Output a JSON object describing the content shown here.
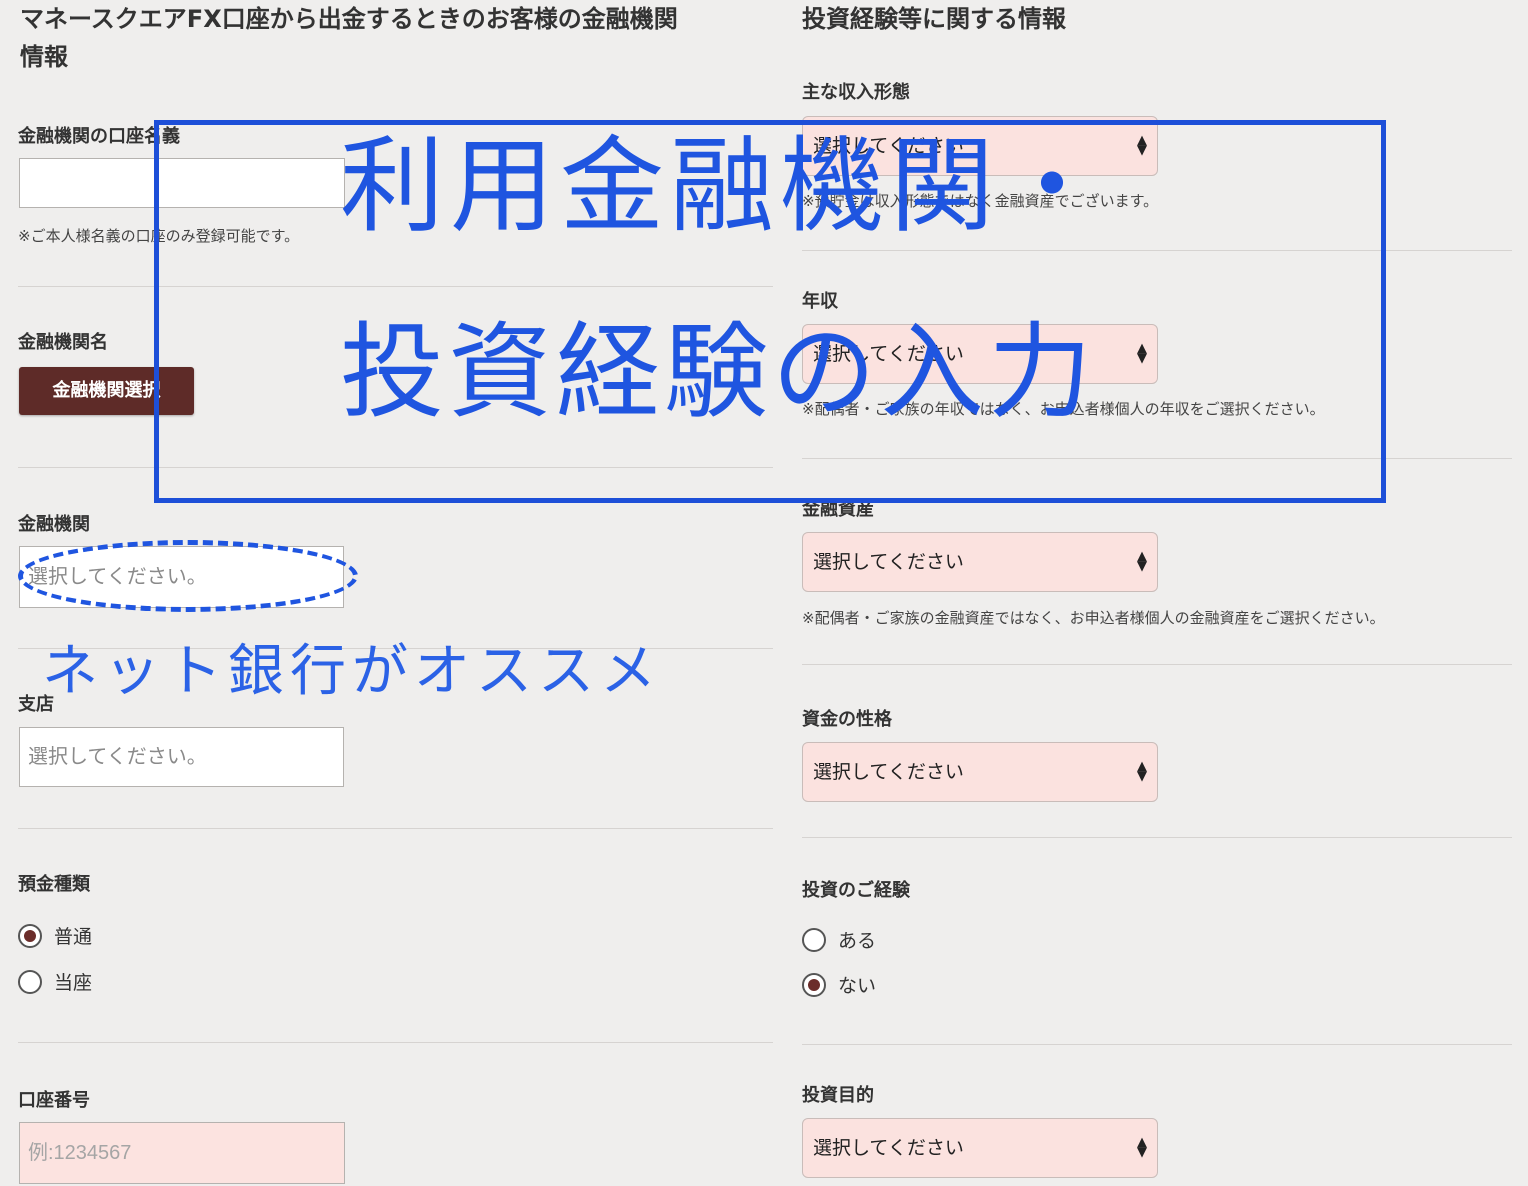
{
  "left": {
    "title": "マネースクエアFX口座から出金するときのお客様の金融機関情報",
    "title_line1": "マネースクエアFX口座から出金するときのお客様の金融機関",
    "title_line2": "情報",
    "account_name": {
      "label": "金融機関の口座名義",
      "value": "",
      "note": "※ご本人様名義の口座のみ登録可能です。"
    },
    "bank_name": {
      "label": "金融機関名",
      "button": "金融機関選択"
    },
    "bank": {
      "label": "金融機関",
      "placeholder": "選択してください。"
    },
    "branch": {
      "label": "支店",
      "placeholder": "選択してください。"
    },
    "deposit_type": {
      "label": "預金種類",
      "options": [
        "普通",
        "当座"
      ],
      "selected": "普通"
    },
    "account_number": {
      "label": "口座番号",
      "placeholder": "例:1234567"
    }
  },
  "right": {
    "title": "投資経験等に関する情報",
    "income_type": {
      "label": "主な収入形態",
      "value": "選択してください",
      "note": "※預貯金は収入形態ではなく金融資産でございます。"
    },
    "annual_income": {
      "label": "年収",
      "value": "選択してください",
      "note": "※配偶者・ご家族の年収ではなく、お申込者様個人の年収をご選択ください。"
    },
    "financial_assets": {
      "label": "金融資産",
      "value": "選択してください",
      "note": "※配偶者・ご家族の金融資産ではなく、お申込者様個人の金融資産をご選択ください。"
    },
    "fund_nature": {
      "label": "資金の性格",
      "value": "選択してください"
    },
    "investment_experience": {
      "label": "投資のご経験",
      "options": [
        "ある",
        "ない"
      ],
      "selected": "ない"
    },
    "investment_purpose": {
      "label": "投資目的",
      "value": "選択してください"
    }
  },
  "overlay": {
    "line1": "利用金融機関・",
    "line2": "投資経験の入力",
    "hint": "ネット銀行がオススメ",
    "color": "#1f55e0"
  },
  "colors": {
    "brand_button": "#5e2b28",
    "select_bg": "#fbe2df",
    "page_bg": "#efeeed"
  }
}
